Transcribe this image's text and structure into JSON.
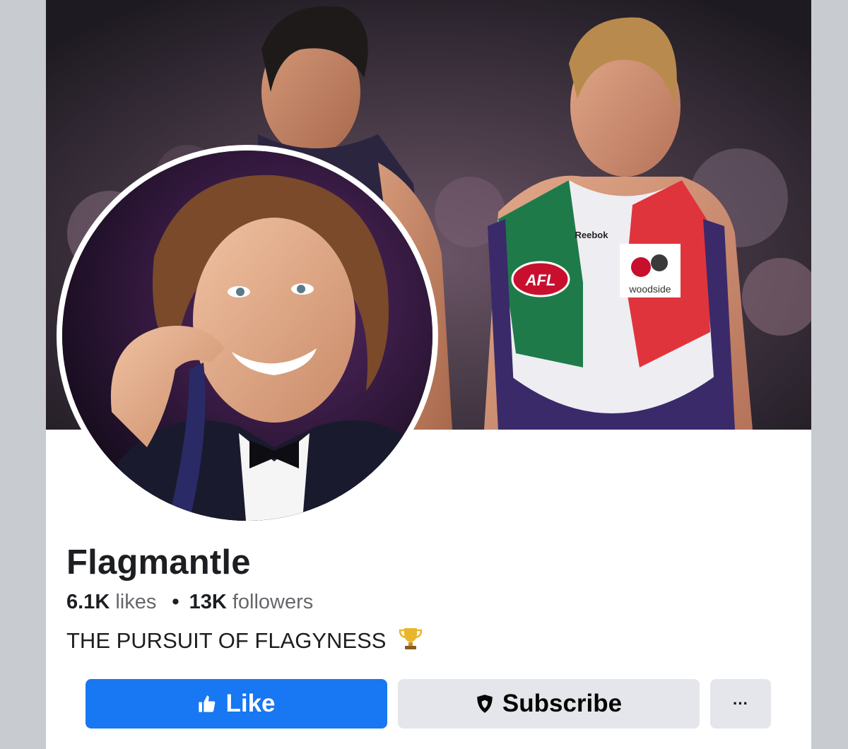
{
  "page": {
    "name": "Flagmantle",
    "likes_count": "6.1K",
    "likes_label": "likes",
    "followers_count": "13K",
    "followers_label": "followers",
    "separator": "•",
    "bio": "THE PURSUIT OF FLAGYNESS",
    "bio_emoji": "trophy-icon"
  },
  "actions": {
    "like_label": "Like",
    "like_icon": "thumbs-up-icon",
    "subscribe_label": "Subscribe",
    "subscribe_icon": "shield-icon",
    "more_label": "···"
  },
  "cover": {
    "jersey_text_left": "Reebok",
    "jersey_badge": "AFL",
    "jersey_sponsor": "woodside"
  },
  "colors": {
    "like_button": "#1877f2",
    "secondary_button": "#e4e6eb",
    "text_primary": "#1c1e21",
    "text_secondary": "#65676b"
  }
}
